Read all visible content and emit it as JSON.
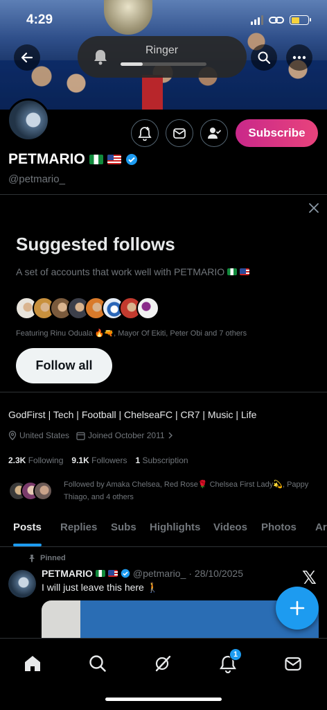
{
  "status_bar": {
    "time": "4:29"
  },
  "ringer_hud": {
    "label": "Ringer",
    "level": 0.26
  },
  "profile": {
    "name": "PETMARIO",
    "handle": "@petmario_",
    "subscribe_label": "Subscribe",
    "bio": "GodFirst | Tech | Football | ChelseaFC | CR7 | Music | Life",
    "location": "United States",
    "joined": "Joined October 2011",
    "following_count": "2.3K",
    "following_label": "Following",
    "followers_count": "9.1K",
    "followers_label": "Followers",
    "subscription_count": "1",
    "subscription_label": "Subscription",
    "followed_by_text": "Followed by Amaka Chelsea, Red Rose🌹 Chelsea First Lady💫, Pappy Thiago, and 4 others"
  },
  "suggested_follows": {
    "title": "Suggested follows",
    "description": "A set of accounts that work well with PETMARIO",
    "featuring": "Featuring Rinu Oduala 🔥🔫, Mayor Of Ekiti, Peter Obi and 7 others",
    "follow_all_label": "Follow all",
    "avatar_colors": [
      "#e8e4dc",
      "#c8903d",
      "#7a5a3c",
      "#3c3f4a",
      "#d97a2a",
      "#e6eef7",
      "#c23a2e",
      "#f2f2f2"
    ]
  },
  "tabs": [
    "Posts",
    "Replies",
    "Subs",
    "Highlights",
    "Videos",
    "Photos",
    "Ar"
  ],
  "active_tab": "Posts",
  "post": {
    "pinned_label": "Pinned",
    "author_name": "PETMARIO",
    "author_handle": "@petmario_",
    "date": "· 28/10/2025",
    "text": "I will just leave this here 🚶"
  },
  "bottom_nav": {
    "items": [
      "home-icon",
      "search-icon",
      "grok-icon",
      "notifications-icon",
      "messages-icon"
    ],
    "notification_badge": "1"
  },
  "colors": {
    "accent": "#1d9bf0",
    "subscribe_start": "#c9288a",
    "subscribe_end": "#e8437c"
  }
}
